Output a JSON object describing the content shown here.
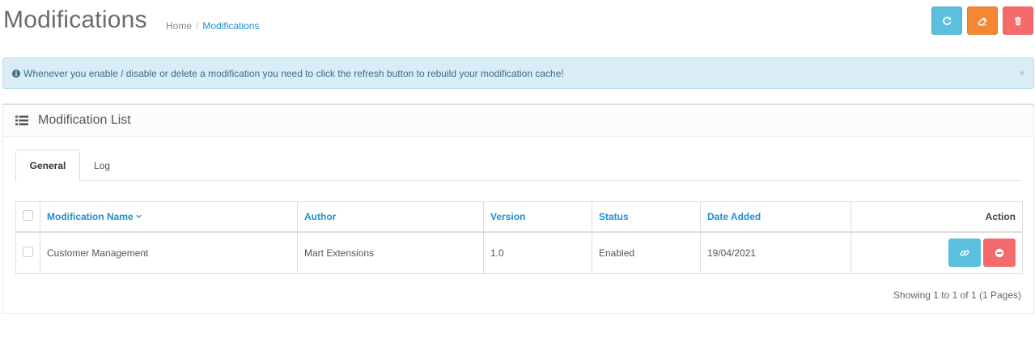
{
  "header": {
    "title": "Modifications",
    "breadcrumb": [
      {
        "label": "Home"
      },
      {
        "label": "Modifications"
      }
    ],
    "actions": [
      {
        "name": "refresh-button",
        "icon": "refresh-icon",
        "color": "#5bc0de"
      },
      {
        "name": "clear-button",
        "icon": "eraser-icon",
        "color": "#f38733"
      },
      {
        "name": "delete-button",
        "icon": "trash-icon",
        "color": "#f56b6b"
      }
    ]
  },
  "alert": {
    "icon": "info-circle-icon",
    "text": "Whenever you enable / disable or delete a modification you need to click the refresh button to rebuild your modification cache!",
    "close": "×"
  },
  "panel": {
    "icon": "list-icon",
    "title": "Modification List"
  },
  "tabs": [
    {
      "label": "General",
      "active": true
    },
    {
      "label": "Log",
      "active": false
    }
  ],
  "table": {
    "columns": [
      "Modification Name",
      "Author",
      "Version",
      "Status",
      "Date Added",
      "Action"
    ],
    "sort_column": "Modification Name",
    "rows": [
      {
        "name": "Customer Management",
        "author": "Mart Extensions",
        "version": "1.0",
        "status": "Enabled",
        "date_added": "19/04/2021",
        "actions": [
          {
            "icon": "link-icon",
            "color": "#5bc0de"
          },
          {
            "icon": "minus-circle-icon",
            "color": "#f56b6b"
          }
        ]
      }
    ]
  },
  "pagination": {
    "results": "Showing 1 to 1 of 1 (1 Pages)"
  }
}
